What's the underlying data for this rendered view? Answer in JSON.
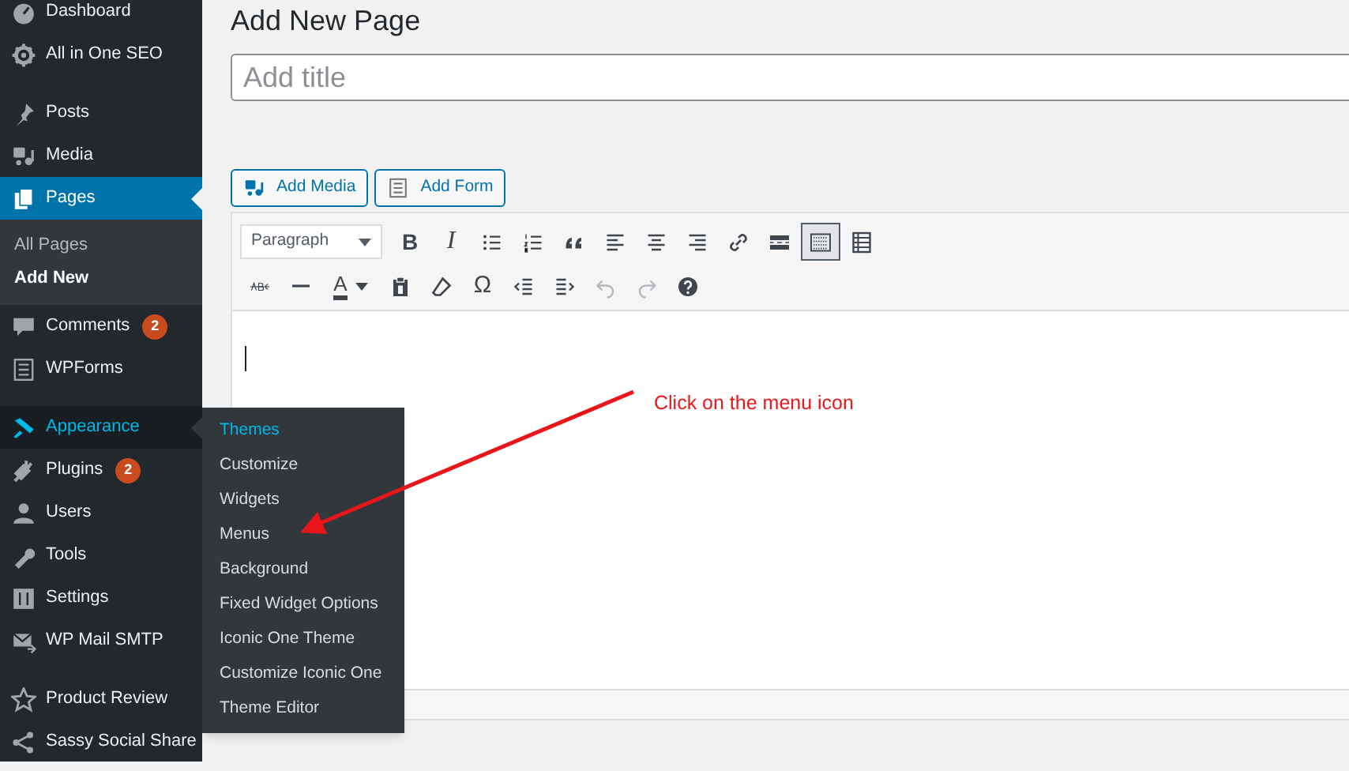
{
  "sidebar": {
    "items": [
      {
        "label": "Dashboard",
        "selected": false,
        "hovered": false
      },
      {
        "label": "All in One SEO",
        "selected": false,
        "hovered": false
      },
      {
        "label": "Posts",
        "selected": false,
        "hovered": false
      },
      {
        "label": "Media",
        "selected": false,
        "hovered": false
      },
      {
        "label": "Pages",
        "selected": true,
        "hovered": false,
        "children": [
          {
            "label": "All Pages",
            "selected": false
          },
          {
            "label": "Add New",
            "selected": true
          }
        ]
      },
      {
        "label": "Comments",
        "selected": false,
        "hovered": false,
        "badge": "2"
      },
      {
        "label": "WPForms",
        "selected": false,
        "hovered": false
      },
      {
        "label": "Appearance",
        "selected": false,
        "hovered": true,
        "flyout": [
          {
            "label": "Themes",
            "selected": true
          },
          {
            "label": "Customize",
            "selected": false
          },
          {
            "label": "Widgets",
            "selected": false
          },
          {
            "label": "Menus",
            "selected": false
          },
          {
            "label": "Background",
            "selected": false
          },
          {
            "label": "Fixed Widget Options",
            "selected": false
          },
          {
            "label": "Iconic One Theme",
            "selected": false
          },
          {
            "label": "Customize Iconic One",
            "selected": false
          },
          {
            "label": "Theme Editor",
            "selected": false
          }
        ]
      },
      {
        "label": "Plugins",
        "selected": false,
        "hovered": false,
        "badge": "2"
      },
      {
        "label": "Users",
        "selected": false,
        "hovered": false
      },
      {
        "label": "Tools",
        "selected": false,
        "hovered": false
      },
      {
        "label": "Settings",
        "selected": false,
        "hovered": false
      },
      {
        "label": "WP Mail SMTP",
        "selected": false,
        "hovered": false
      },
      {
        "label": "Product Review",
        "selected": false,
        "hovered": false
      },
      {
        "label": "Sassy Social Share",
        "selected": false,
        "hovered": false
      }
    ]
  },
  "page": {
    "heading": "Add New Page",
    "title_field": {
      "placeholder": "Add title"
    }
  },
  "media_buttons": [
    {
      "label": "Add Media"
    },
    {
      "label": "Add Form"
    }
  ],
  "editor": {
    "format_select": "Paragraph",
    "toolbar_rows": [
      [
        {
          "kind": "bold",
          "label": "B",
          "disabled": false,
          "pressed": false
        },
        {
          "kind": "italic",
          "label": "I",
          "disabled": false,
          "pressed": false
        },
        {
          "kind": "bullets",
          "disabled": false,
          "pressed": false
        },
        {
          "kind": "numbers",
          "disabled": false,
          "pressed": false
        },
        {
          "kind": "quote",
          "disabled": false,
          "pressed": false
        },
        {
          "kind": "align-left",
          "disabled": false,
          "pressed": false
        },
        {
          "kind": "align-center",
          "disabled": false,
          "pressed": false
        },
        {
          "kind": "align-right",
          "disabled": false,
          "pressed": false
        },
        {
          "kind": "link",
          "disabled": false,
          "pressed": false
        },
        {
          "kind": "more",
          "disabled": false,
          "pressed": false
        },
        {
          "kind": "toolbar-toggle",
          "disabled": false,
          "pressed": true
        },
        {
          "kind": "table",
          "disabled": false,
          "pressed": false
        }
      ],
      [
        {
          "kind": "strike",
          "disabled": false,
          "pressed": false
        },
        {
          "kind": "hr",
          "disabled": false,
          "pressed": false
        },
        {
          "kind": "color",
          "label": "A",
          "disabled": false,
          "pressed": false
        },
        {
          "kind": "paste",
          "disabled": false,
          "pressed": false
        },
        {
          "kind": "eraser",
          "disabled": false,
          "pressed": false
        },
        {
          "kind": "omega",
          "label": "Ω",
          "disabled": false,
          "pressed": false
        },
        {
          "kind": "outdent",
          "disabled": false,
          "pressed": false
        },
        {
          "kind": "indent",
          "disabled": false,
          "pressed": false
        },
        {
          "kind": "undo",
          "disabled": true,
          "pressed": false
        },
        {
          "kind": "redo",
          "disabled": true,
          "pressed": false
        },
        {
          "kind": "help",
          "disabled": false,
          "pressed": false
        }
      ]
    ]
  },
  "annotation": {
    "text": "Click on the menu icon"
  }
}
